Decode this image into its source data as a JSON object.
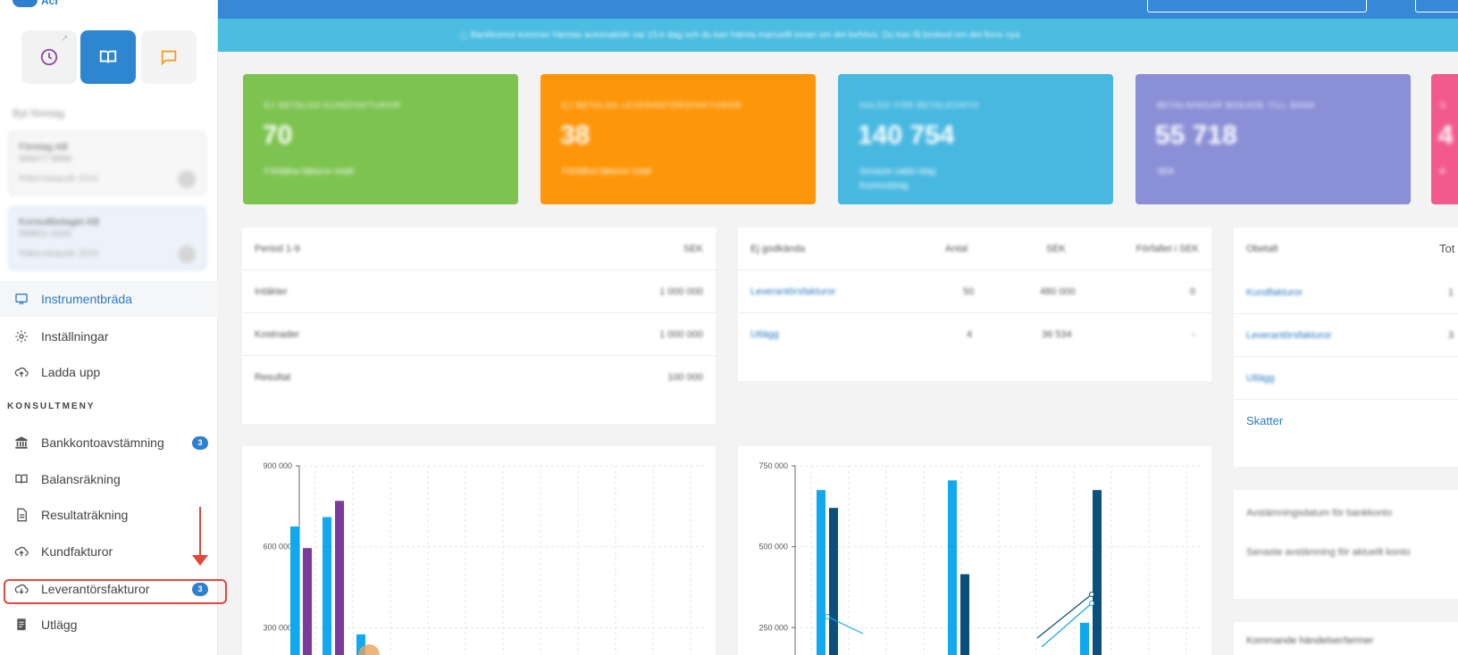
{
  "sidebar": {
    "logo_text": "Acr",
    "top_buttons": [
      "clock",
      "book",
      "chat"
    ],
    "blurred": {
      "header": "Byt företag",
      "card1": {
        "name": "Företag AB",
        "sub": "556677-8899",
        "meta": "Räkenskapsår 2024"
      },
      "card2": {
        "name": "Konsultbolaget AB",
        "sub": "559911-2233",
        "meta": "Räkenskapsår 2024"
      }
    },
    "nav_top": [
      {
        "label": "Instrumentbräda",
        "icon": "monitor-icon",
        "active": true
      },
      {
        "label": "Inställningar",
        "icon": "gear-icon"
      },
      {
        "label": "Ladda upp",
        "icon": "cloud-upload-icon"
      }
    ],
    "section_label": "KONSULTMENY",
    "nav_consult": [
      {
        "label": "Bankkontoavstämning",
        "icon": "bank-icon",
        "badge": "3"
      },
      {
        "label": "Balansräkning",
        "icon": "book-icon"
      },
      {
        "label": "Resultaträkning",
        "icon": "document-icon"
      },
      {
        "label": "Kundfakturor",
        "icon": "cloud-upload-icon"
      },
      {
        "label": "Leverantörsfakturor",
        "icon": "cloud-download-icon",
        "badge": "3"
      },
      {
        "label": "Utlägg",
        "icon": "receipt-icon"
      }
    ]
  },
  "banner": {
    "text": "Bankkontot kommer hämtas automatiskt var 15:e dag och du kan hämta manuellt innan om det behövs. Du kan få besked om det finns nya"
  },
  "stats": [
    {
      "label": "EJ BETALDA KUNDFAKTUROR",
      "value": "70",
      "sub": "Förfallna fakturor totalt",
      "color": "#7cc34f"
    },
    {
      "label": "EJ BETALDA LEVERANTÖRSFAKTUROR",
      "value": "38",
      "sub": "Förfallna fakturor totalt",
      "color": "#fd9608"
    },
    {
      "label": "SALDO FÖR BETALKONTO",
      "value": "140 754",
      "sub": "Senaste saldo idag",
      "sub2": "Kontoutdrag",
      "color": "#47b8e0"
    },
    {
      "label": "BETALNINGAR BOKADE TILL BANK",
      "value": "55 718",
      "sub": "SEK",
      "color": "#8a8fd6"
    },
    {
      "label": "S",
      "value": "4",
      "sub": "K",
      "color": "#f25a8e"
    }
  ],
  "result_table": {
    "header": [
      "Period 1-9",
      "SEK"
    ],
    "rows": [
      {
        "label": "Intäkter",
        "value": "1 000 000"
      },
      {
        "label": "Kostnader",
        "value": "1 000 000"
      },
      {
        "label": "Resultat",
        "value": "100 000"
      }
    ]
  },
  "payables_table": {
    "header": [
      "Ej godkända",
      "Antal",
      "SEK",
      "Förfallet i SEK"
    ],
    "rows": [
      {
        "label": "Leverantörsfakturor",
        "count": "50",
        "amount": "480 000",
        "due": "0"
      },
      {
        "label": "Utlägg",
        "count": "4",
        "amount": "36 534",
        "due": "-"
      }
    ]
  },
  "unpaid_table": {
    "header": [
      "Obetalt",
      "Tot"
    ],
    "rows": [
      {
        "label": "Kundfakturor",
        "value": "1"
      },
      {
        "label": "Leverantörsfakturor",
        "value": "3"
      },
      {
        "label": "Utlägg",
        "value": ""
      },
      {
        "label": "Skatter",
        "value": ""
      }
    ]
  },
  "side_notes": {
    "note1": "Avstämningsdatum för bankkonto",
    "note2": "Senaste avstämning för aktuellt konto",
    "note3": "Kommande händelser/termer"
  },
  "chart_data": [
    {
      "type": "bar",
      "ylim": [
        0,
        900000
      ],
      "yticks": [
        "900 000",
        "600 000",
        "300 000"
      ],
      "series": [
        {
          "values": [
            675000,
            710000,
            275000
          ],
          "color": "#10a8ef"
        },
        {
          "values": [
            595000,
            770000,
            135000
          ],
          "color": "#7c3a9a"
        }
      ]
    },
    {
      "type": "bar",
      "ylim": [
        0,
        750000
      ],
      "yticks": [
        "750 000",
        "500 000",
        "250 000"
      ],
      "series": [
        {
          "values": [
            675000,
            705000,
            265000
          ],
          "color": "#10a8ef"
        },
        {
          "values": [
            620000,
            415000,
            675000
          ],
          "color": "#0b4f7a"
        }
      ]
    }
  ]
}
